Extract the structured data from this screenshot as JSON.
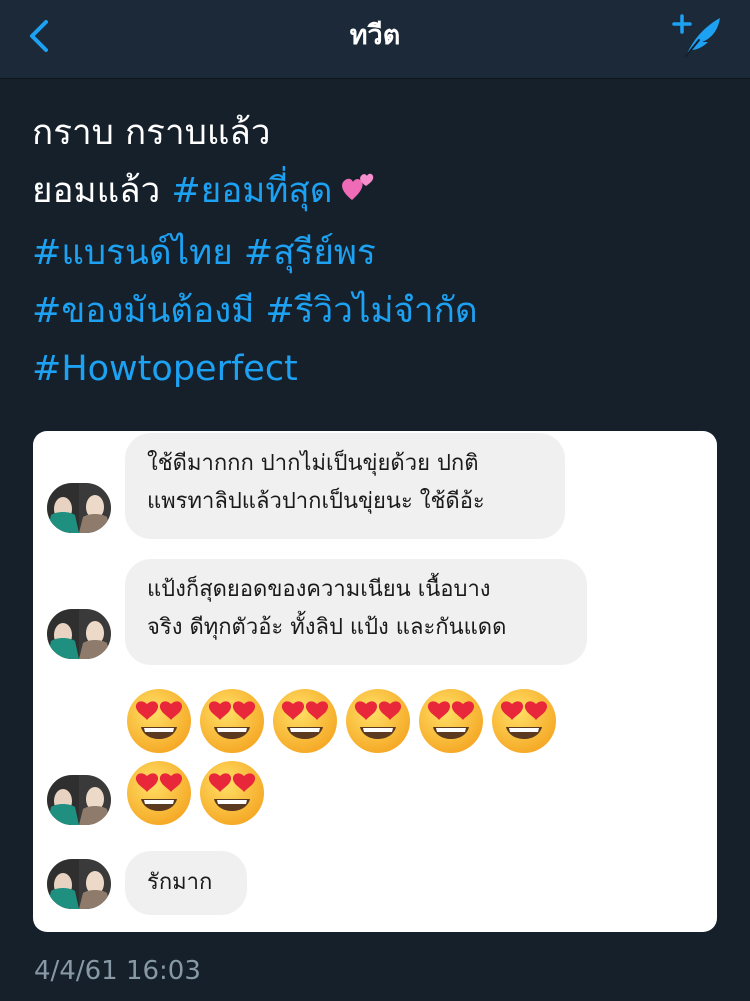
{
  "header": {
    "title": "ทวีต",
    "back_icon": "chevron-left-icon",
    "compose_icon": "compose-tweet-icon"
  },
  "tweet": {
    "line1": "กราบ กราบแล้ว",
    "line2_text": "ยอมแล้ว ",
    "line2_hashtag": "#ยอมที่สุด",
    "line2_emoji": "two-hearts-icon",
    "line3_hashtag1": "#แบรนด์ไทย",
    "line3_hashtag2": "#สุรีย์พร",
    "line4_hashtag1": "#ของมันต้องมี",
    "line4_hashtag2": "#รีวิวไม่จำกัด",
    "line5_hashtag": "#Howtoperfect",
    "timestamp": "4/4/61 16:03"
  },
  "chat": {
    "messages": [
      {
        "lines": [
          "ใช้ดีมากกก ปากไม่เป็นขุ่ยด้วย ปกติ",
          "แพรทาลิปแล้วปากเป็นขุ่ยนะ ใช้ดีอ้ะ"
        ]
      },
      {
        "lines": [
          "แป้งก็สุดยอดของความเนียน เนื้อบาง",
          "จริง ดีทุกตัวอ้ะ ทั้งลิป แป้ง และกันแดด"
        ]
      },
      {
        "emoji": "heart-eyes-emoji",
        "count": 8
      },
      {
        "lines": [
          "รักมาก"
        ]
      }
    ]
  },
  "colors": {
    "background": "#15202b",
    "header": "#1c2938",
    "accent": "#1da1f2",
    "bubble": "#f1f0f0",
    "secondary_text": "#8899a6"
  }
}
